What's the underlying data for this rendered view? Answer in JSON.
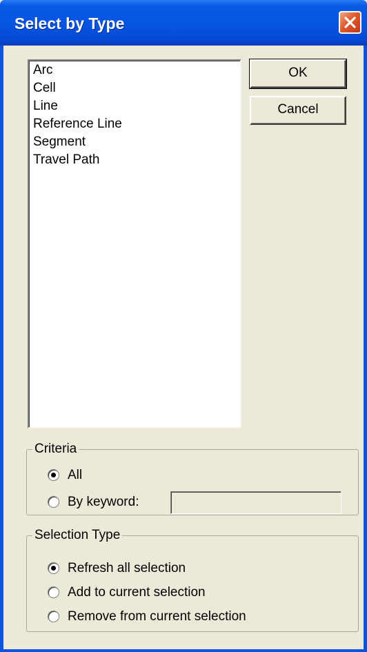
{
  "window": {
    "title": "Select by Type",
    "close_icon": "close-x-icon",
    "colors": {
      "title_bar": "#0654e2",
      "close_button": "#e05a2c",
      "dialog_bg": "#ece9d8"
    }
  },
  "type_list": {
    "items": [
      "Arc",
      "Cell",
      "Line",
      "Reference Line",
      "Segment",
      "Travel Path"
    ]
  },
  "buttons": {
    "ok": "OK",
    "cancel": "Cancel"
  },
  "criteria": {
    "legend": "Criteria",
    "options": [
      {
        "label": "All",
        "checked": true
      },
      {
        "label": "By keyword:",
        "checked": false
      }
    ],
    "keyword_value": ""
  },
  "selection_type": {
    "legend": "Selection Type",
    "options": [
      {
        "label": "Refresh all selection",
        "checked": true
      },
      {
        "label": "Add to current selection",
        "checked": false
      },
      {
        "label": "Remove from current selection",
        "checked": false
      }
    ]
  }
}
